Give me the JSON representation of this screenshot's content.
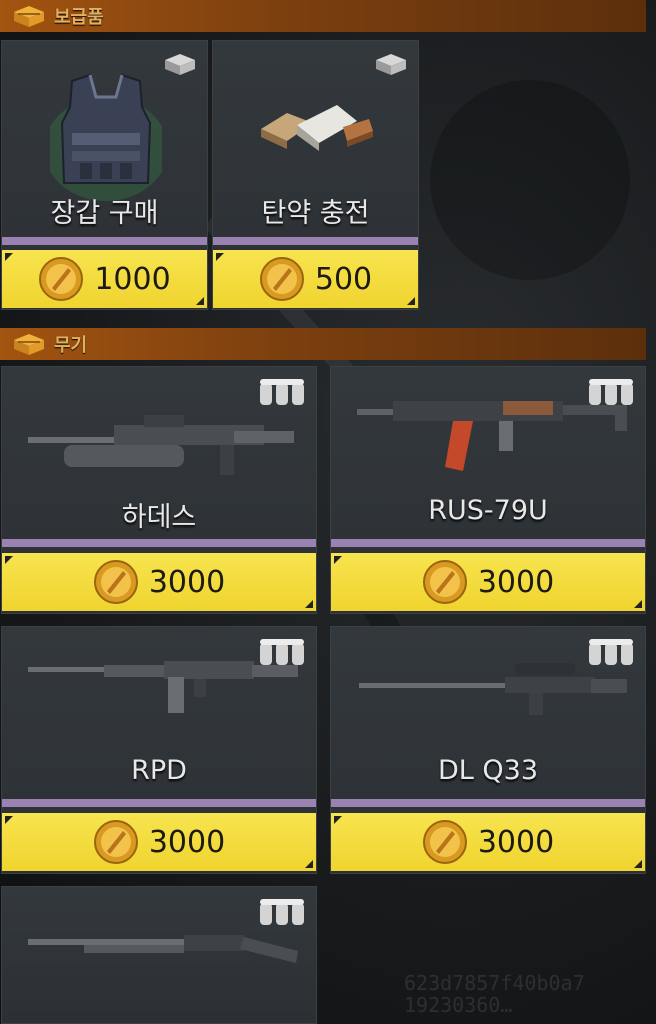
{
  "sections": {
    "supplies": {
      "title": "보급품",
      "items": [
        {
          "label": "장갑 구매",
          "price": "1000",
          "icon": "body-armor-icon",
          "type_icon": "supply-box-icon"
        },
        {
          "label": "탄약 충전",
          "price": "500",
          "icon": "ammo-pack-icon",
          "type_icon": "supply-box-icon"
        }
      ]
    },
    "weapons": {
      "title": "무기",
      "items": [
        {
          "label": "하데스",
          "price": "3000",
          "icon": "grenade-launcher-icon",
          "type_icon": "ammo-rounds-icon"
        },
        {
          "label": "RUS-79U",
          "price": "3000",
          "icon": "assault-rifle-icon",
          "type_icon": "ammo-rounds-icon"
        },
        {
          "label": "RPD",
          "price": "3000",
          "icon": "machine-gun-icon",
          "type_icon": "ammo-rounds-icon"
        },
        {
          "label": "DL Q33",
          "price": "3000",
          "icon": "sniper-rifle-icon",
          "type_icon": "ammo-rounds-icon"
        },
        {
          "label": "",
          "price": "",
          "icon": "shotgun-icon",
          "type_icon": "ammo-rounds-icon"
        }
      ]
    }
  },
  "watermark": "623d7857f40b0a7\n19230360…",
  "colors": {
    "price_bar": "#f0d42f",
    "accent_strip": "#9a82b3",
    "section_bar": "#a25410",
    "section_title": "#e2b061"
  }
}
